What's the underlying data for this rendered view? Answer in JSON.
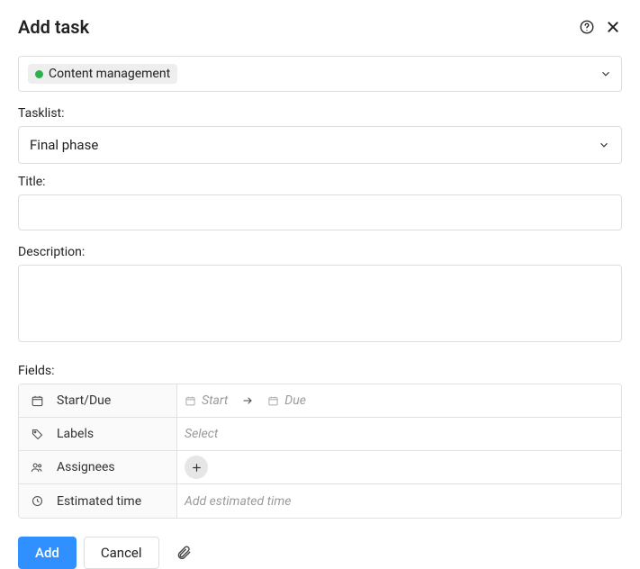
{
  "header": {
    "title": "Add task"
  },
  "project": {
    "name": "Content management",
    "status_color": "#2bb24c"
  },
  "tasklist": {
    "label": "Tasklist:",
    "value": "Final phase"
  },
  "title_field": {
    "label": "Title:",
    "value": ""
  },
  "description": {
    "label": "Description:",
    "value": ""
  },
  "fields": {
    "label": "Fields:",
    "rows": {
      "startdue": {
        "label": "Start/Due",
        "start_placeholder": "Start",
        "due_placeholder": "Due"
      },
      "labels": {
        "label": "Labels",
        "placeholder": "Select"
      },
      "assignees": {
        "label": "Assignees"
      },
      "estimated": {
        "label": "Estimated time",
        "placeholder": "Add estimated time"
      }
    }
  },
  "footer": {
    "add": "Add",
    "cancel": "Cancel"
  }
}
